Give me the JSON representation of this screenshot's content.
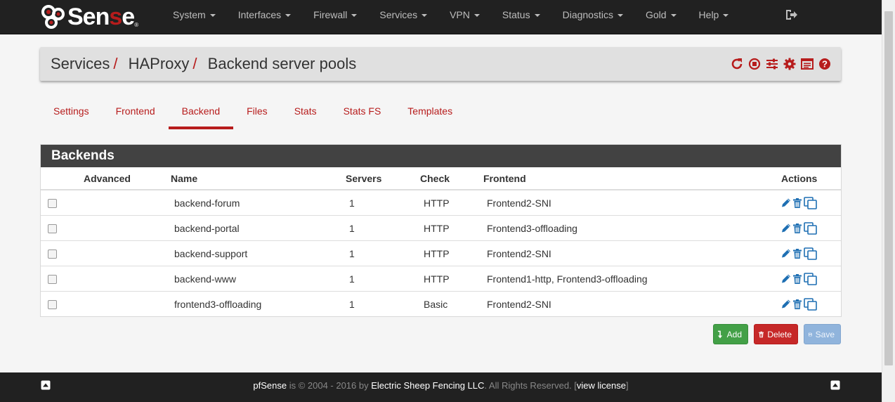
{
  "nav": {
    "logo_prefix": "Sen",
    "logo_red": "s",
    "logo_suffix": "e",
    "logo_reg": "®",
    "items": [
      {
        "label": "System"
      },
      {
        "label": "Interfaces"
      },
      {
        "label": "Firewall"
      },
      {
        "label": "Services"
      },
      {
        "label": "VPN"
      },
      {
        "label": "Status"
      },
      {
        "label": "Diagnostics"
      },
      {
        "label": "Gold"
      },
      {
        "label": "Help"
      }
    ],
    "logout_icon": "sign-out-icon"
  },
  "breadcrumb": {
    "items": [
      "Services",
      "HAProxy",
      "Backend server pools"
    ],
    "separator": "/",
    "icons": [
      "restart-icon",
      "stop-icon",
      "sliders-icon",
      "gear-icon",
      "log-icon",
      "help-icon"
    ]
  },
  "tabs": [
    {
      "label": "Settings"
    },
    {
      "label": "Frontend"
    },
    {
      "label": "Backend",
      "active": true
    },
    {
      "label": "Files"
    },
    {
      "label": "Stats"
    },
    {
      "label": "Stats FS"
    },
    {
      "label": "Templates"
    }
  ],
  "panel": {
    "title": "Backends",
    "columns": {
      "advanced": "Advanced",
      "name": "Name",
      "servers": "Servers",
      "check": "Check",
      "frontend": "Frontend",
      "actions": "Actions"
    },
    "rows": [
      {
        "name": "backend-forum",
        "servers": "1",
        "check": "HTTP",
        "frontend": "Frontend2-SNI"
      },
      {
        "name": "backend-portal",
        "servers": "1",
        "check": "HTTP",
        "frontend": "Frontend3-offloading"
      },
      {
        "name": "backend-support",
        "servers": "1",
        "check": "HTTP",
        "frontend": "Frontend2-SNI"
      },
      {
        "name": "backend-www",
        "servers": "1",
        "check": "HTTP",
        "frontend": "Frontend1-http, Frontend3-offloading"
      },
      {
        "name": "frontend3-offloading",
        "servers": "1",
        "check": "Basic",
        "frontend": "Frontend2-SNI"
      }
    ]
  },
  "buttons": {
    "add": "Add",
    "delete": "Delete",
    "save": "Save"
  },
  "footer": {
    "brand": "pfSense",
    "is": "is © 2004 - 2016 by",
    "company": "Electric Sheep Fencing LLC",
    "rights": ". All Rights Reserved. [",
    "license": "view license",
    "close": "]"
  },
  "colors": {
    "navbar": "#212121",
    "accent_red": "#b71c1c",
    "panel_heading": "#424242",
    "action_blue": "#1e6fb3",
    "add_green": "#43a047",
    "delete_red": "#c62828",
    "save_blue": "#90b4dc"
  }
}
